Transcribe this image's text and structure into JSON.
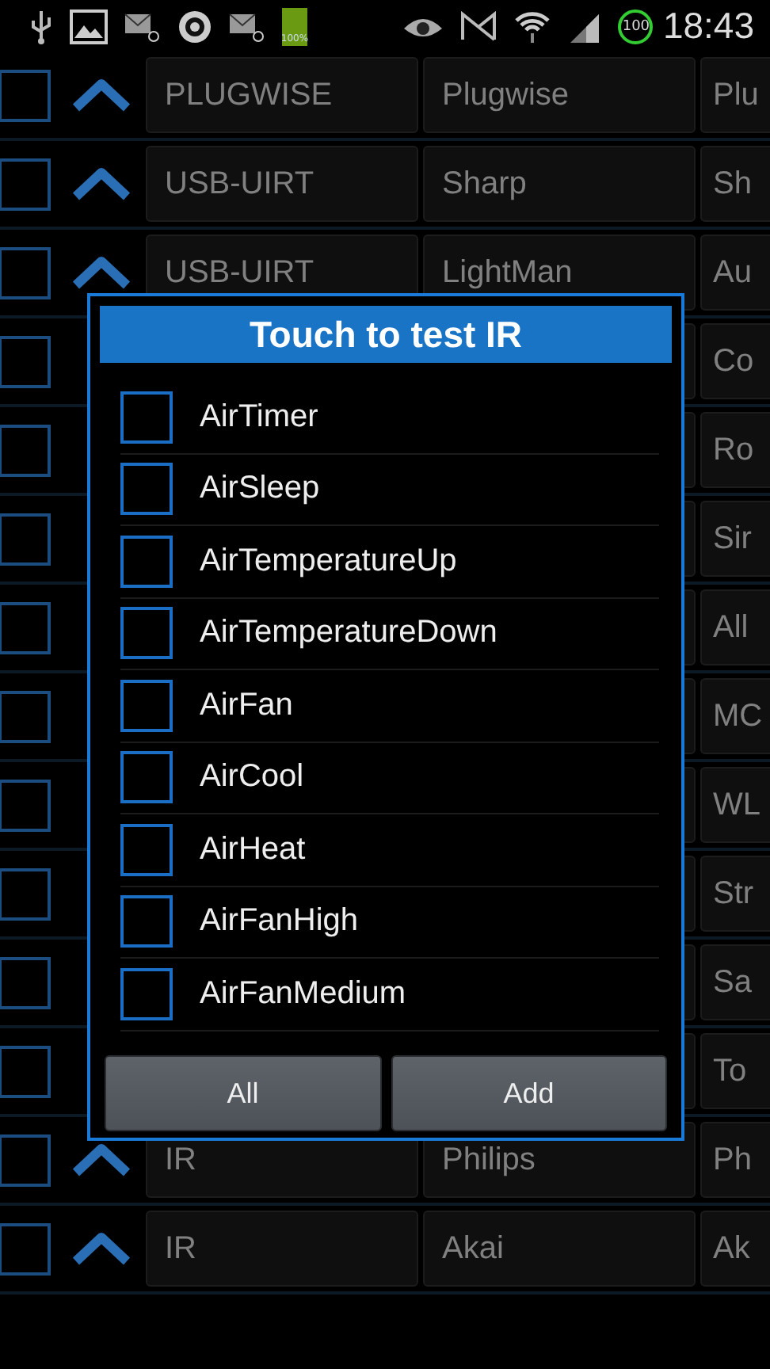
{
  "status_bar": {
    "battery_text": "100%",
    "badge": "100",
    "time": "18:43"
  },
  "rows": [
    {
      "checked": false,
      "col1": "PLUGWISE",
      "col2": "Plugwise",
      "col3": "Plu"
    },
    {
      "checked": false,
      "col1": "USB-UIRT",
      "col2": "Sharp",
      "col3": "Sh"
    },
    {
      "checked": false,
      "col1": "USB-UIRT",
      "col2": "LightMan",
      "col3": "Au"
    },
    {
      "checked": false,
      "col3": "Co"
    },
    {
      "checked": false,
      "col3": "Ro"
    },
    {
      "checked": false,
      "col3": "Sir"
    },
    {
      "checked": false,
      "col3": "All"
    },
    {
      "checked": false,
      "col3": "MC"
    },
    {
      "checked": false,
      "col3": "WL"
    },
    {
      "checked": false,
      "col3": "Str"
    },
    {
      "checked": false,
      "col3": "Sa"
    },
    {
      "checked": false,
      "col3": "To"
    },
    {
      "checked": false,
      "col1": "IR",
      "col2": "Philips",
      "col3": "Ph"
    },
    {
      "checked": false,
      "col1": "IR",
      "col2": "Akai",
      "col3": "Ak"
    }
  ],
  "dialog": {
    "title": "Touch to test IR",
    "items": [
      {
        "label": "AirTimer",
        "checked": false
      },
      {
        "label": "AirSleep",
        "checked": false
      },
      {
        "label": "AirTemperatureUp",
        "checked": false
      },
      {
        "label": "AirTemperatureDown",
        "checked": false
      },
      {
        "label": "AirFan",
        "checked": false
      },
      {
        "label": "AirCool",
        "checked": false
      },
      {
        "label": "AirHeat",
        "checked": false
      },
      {
        "label": "AirFanHigh",
        "checked": false
      },
      {
        "label": "AirFanMedium",
        "checked": false
      }
    ],
    "buttons": [
      "All",
      "Add"
    ]
  }
}
